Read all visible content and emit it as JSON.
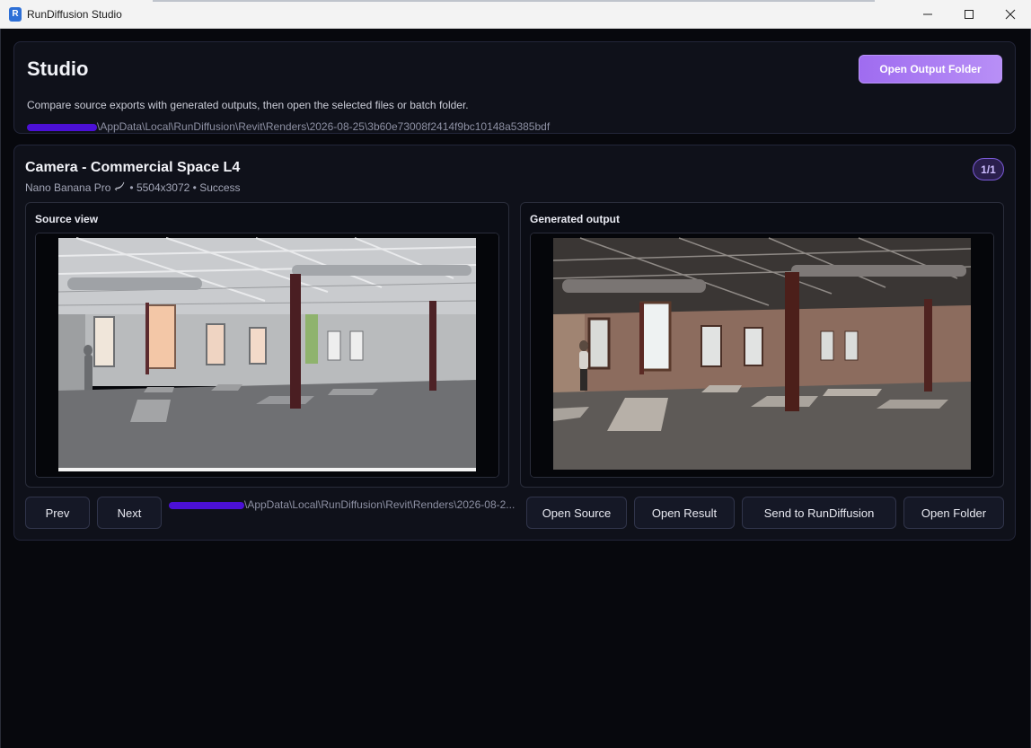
{
  "window": {
    "title": "RunDiffusion Studio",
    "app_icon_letter": "R",
    "controls": [
      "minimize-icon",
      "maximize-icon",
      "close-icon"
    ]
  },
  "header": {
    "title": "Studio",
    "description": "Compare source exports with generated outputs, then open the selected files or batch folder.",
    "path_visible": "\\AppData\\Local\\RunDiffusion\\Revit\\Renders\\2026-08-25\\3b60e73008f2414f9bc10148a5385bdf",
    "open_output_folder_label": "Open Output Folder"
  },
  "camera": {
    "title": "Camera - Commercial Space L4",
    "model": "Nano Banana Pro",
    "model_icon": "banana-icon",
    "details": "• 5504x3072 • Success",
    "counter": "1/1"
  },
  "panels": {
    "source_label": "Source view",
    "generated_label": "Generated output"
  },
  "nav": {
    "prev_label": "Prev",
    "next_label": "Next",
    "path_visible": "\\AppData\\Local\\RunDiffusion\\Revit\\Renders\\2026-08-2..."
  },
  "actions": {
    "open_source_label": "Open Source",
    "open_result_label": "Open Result",
    "send_label": "Send to RunDiffusion",
    "open_folder_label": "Open Folder"
  },
  "colors": {
    "accent": "#a57af2",
    "background": "#07080d",
    "card": "#0f111a",
    "redaction": "#4b10d6"
  }
}
